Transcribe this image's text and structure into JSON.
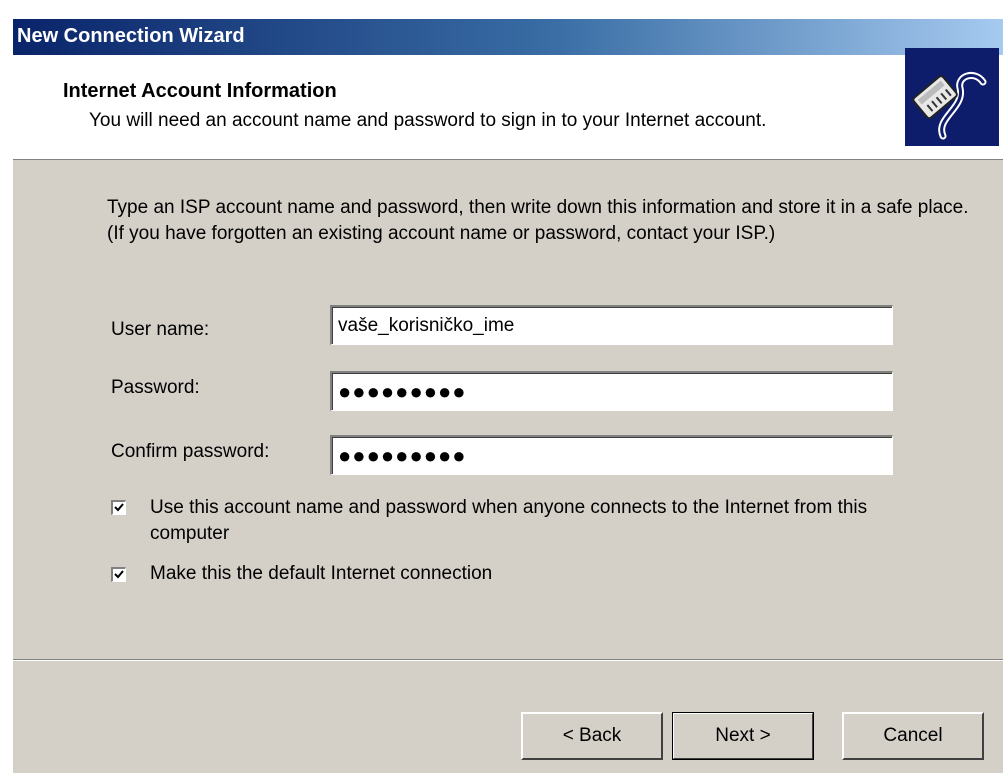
{
  "window": {
    "title": "New Connection Wizard"
  },
  "header": {
    "title": "Internet Account Information",
    "subtitle": "You will need an account name and password to sign in to your Internet account.",
    "icon": "network-cable-icon"
  },
  "intro": {
    "text": "Type an ISP account name and password, then write down this information and store it in a safe place. (If you have forgotten an existing account name or password, contact your ISP.)"
  },
  "form": {
    "username_label": "User name:",
    "username_value": "vaše_korisničko_ime",
    "password_label": "Password:",
    "password_value": "●●●●●●●●●",
    "confirm_label": "Confirm password:",
    "confirm_value": "●●●●●●●●●"
  },
  "options": [
    {
      "label": "Use this account  name and password when anyone connects to the Internet from this computer",
      "checked": true
    },
    {
      "label": "Make this the default Internet connection",
      "checked": true
    }
  ],
  "buttons": {
    "back": "< Back",
    "next": "Next >",
    "cancel": "Cancel"
  },
  "colors": {
    "titlebar_start": "#0a246a",
    "titlebar_end": "#a6caf0",
    "dialog_face": "#d4d0c8"
  }
}
